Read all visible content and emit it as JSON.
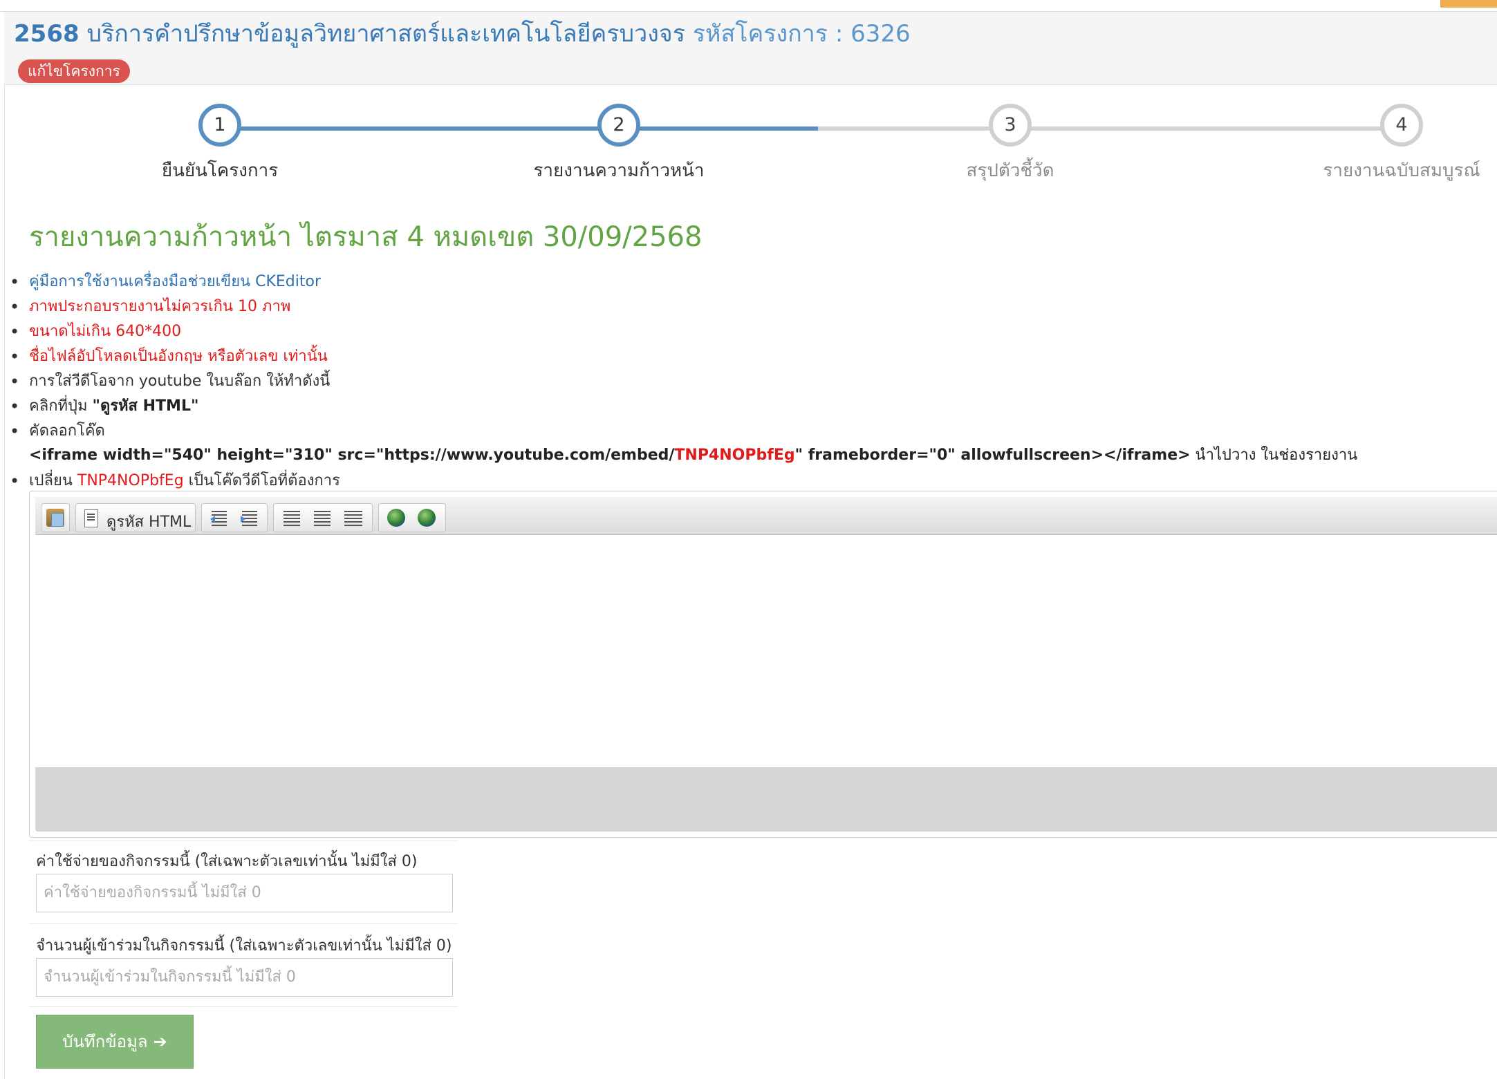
{
  "header": {
    "year": "2568",
    "project_name": "บริการคำปรึกษาข้อมูลวิทยาศาสตร์และเทคโนโลยีครบวงจร",
    "project_code": "รหัสโครงการ : 6326",
    "edit_badge": "แก้ไขโครงการ"
  },
  "wizard": {
    "steps": [
      {
        "number": "1",
        "label": "ยืนยันโครงการ",
        "state": "active"
      },
      {
        "number": "2",
        "label": "รายงานความก้าวหน้า",
        "state": "active"
      },
      {
        "number": "3",
        "label": "สรุปตัวชี้วัด",
        "state": "pending"
      },
      {
        "number": "4",
        "label": "รายงานฉบับสมบูรณ์",
        "state": "pending"
      }
    ]
  },
  "report_heading": "รายงานความก้าวหน้า ไตรมาส 4 หมดเขต 30/09/2568",
  "instructions": {
    "manual_link": "คู่มือการใช้งานเครื่องมือช่วยเขียน CKEditor",
    "image_limit": "ภาพประกอบรายงานไม่ควรเกิน 10 ภาพ",
    "size_limit": "ขนาดไม่เกิน 640*400",
    "filename_rule": "ชื่อไฟล์อัปโหลดเป็นอังกฤษ หรือตัวเลข เท่านั้น",
    "youtube_intro": "การใส่วีดีโอจาก youtube ในบล๊อก ให้ทำดังนี้",
    "click_prefix": "คลิกที่ปุ่ม ",
    "click_button": "\"ดูรหัส HTML\"",
    "copy_code": "คัดลอกโค๊ด",
    "iframe_prefix": "<iframe width=\"540\" height=\"310\" src=\"https://www.youtube.com/embed/",
    "video_id": "TNP4NOPbfEg",
    "iframe_suffix": "\" frameborder=\"0\" allowfullscreen></iframe>",
    "paste_note": " นำไปวาง ในช่องรายงาน",
    "replace_prefix": "เปลี่ยน ",
    "replace_suffix": " เป็นโค๊ดวีดีโอที่ต้องการ"
  },
  "editor": {
    "source_button": "ดูรหัส HTML",
    "toolbar_icons": [
      "paste-icon",
      "view-source-icon",
      "outdent-icon",
      "indent-icon",
      "align-center-icon",
      "align-right-icon",
      "justify-icon",
      "link-globe-icon",
      "unlink-globe-icon"
    ]
  },
  "form": {
    "expense_label": "ค่าใช้จ่ายของกิจกรรมนี้ (ใส่เฉพาะตัวเลขเท่านั้น ไม่มีใส่ 0)",
    "expense_placeholder": "ค่าใช้จ่ายของกิจกรรมนี้ ไม่มีใส่ 0",
    "participants_label": "จำนวนผู้เข้าร่วมในกิจกรรมนี้ (ใส่เฉพาะตัวเลขเท่านั้น ไม่มีใส่ 0)",
    "participants_placeholder": "จำนวนผู้เข้าร่วมในกิจกรรมนี้ ไม่มีใส่ 0",
    "save_button": "บันทึกข้อมูล",
    "save_arrow": "➔"
  },
  "colors": {
    "title_blue": "#3a7ab7",
    "progress_active": "#5a8fc2",
    "progress_pending": "#d3d4d7",
    "heading_green": "#62a343",
    "warning_red": "#e11b1b",
    "badge_red": "#d9534f",
    "save_green": "#85b97a"
  }
}
